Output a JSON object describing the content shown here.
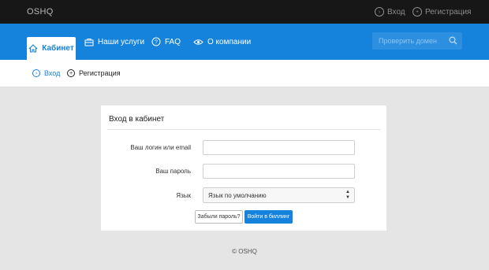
{
  "topbar": {
    "brand": "OSHQ",
    "links": [
      {
        "label": "Вход",
        "icon": "arrow-right-circle-icon"
      },
      {
        "label": "Регистрация",
        "icon": "plus-circle-icon"
      }
    ]
  },
  "nav": {
    "items": [
      {
        "label": "Кабинет",
        "icon": "home-icon",
        "active": true
      },
      {
        "label": "Наши услуги",
        "icon": "briefcase-icon"
      },
      {
        "label": "FAQ",
        "icon": "question-circle-icon"
      },
      {
        "label": "О компании",
        "icon": "eye-icon"
      }
    ],
    "search_placeholder": "Проверить домен"
  },
  "subnav": {
    "items": [
      {
        "label": "Вход",
        "icon": "arrow-right-circle-icon",
        "active": true
      },
      {
        "label": "Регистрация",
        "icon": "plus-circle-icon"
      }
    ]
  },
  "login": {
    "title": "Вход в кабинет",
    "login_label": "Ваш логин или email",
    "password_label": "Ваш пароль",
    "language_label": "Язык",
    "language_value": "Язык по умолчанию",
    "forgot_button": "Забыли пароль?",
    "submit_button": "Войти в биллинг"
  },
  "footer": "© OSHQ",
  "colors": {
    "accent": "#1582db",
    "topbar": "#171717",
    "background": "#e5e5e5"
  }
}
